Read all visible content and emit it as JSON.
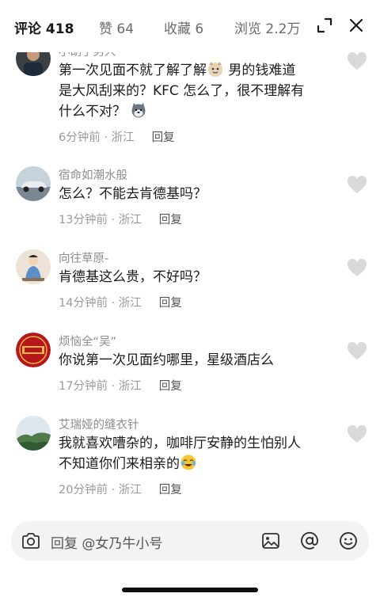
{
  "header": {
    "tabs": [
      {
        "label": "评论 418"
      },
      {
        "label": "赞 64"
      },
      {
        "label": "收藏 6"
      },
      {
        "label": "浏览 2.2万"
      }
    ]
  },
  "comments": [
    {
      "username": "小胡子男人",
      "text_line1": "第一次见面不就了解了解",
      "text_line1b": "男的钱难道",
      "text_line2": "是大风刮来的？KFC 怎么了，很不理解有",
      "text_line3": "什么不对？",
      "time": "6分钟前 · 浙江",
      "reply": "回复"
    },
    {
      "username": "宿命如潮水般",
      "text": "怎么？不能去肯德基吗？",
      "time": "13分钟前 · 浙江",
      "reply": "回复"
    },
    {
      "username": "向往草原-",
      "text": "肯德基这么贵，不好吗？",
      "time": "14分钟前 · 浙江",
      "reply": "回复"
    },
    {
      "username": "烦恼全“吴”",
      "text": "你说第一次见面约哪里，星级酒店么",
      "time": "17分钟前 · 浙江",
      "reply": "回复"
    },
    {
      "username": "艾瑞娅的缝衣针",
      "text_line1": "我就喜欢嘈杂的，咖啡厅安静的生怕别人",
      "text_line2": "不知道你们来相亲的",
      "time": "20分钟前 · 浙江",
      "reply": "回复"
    }
  ],
  "composer": {
    "placeholder": "回复 @女乃牛小号"
  },
  "colors": {
    "text_primary": "#1b1b1b",
    "text_secondary": "#9a9a9a",
    "heart": "#d9d9d9",
    "input_bg": "#f3f3f3"
  }
}
